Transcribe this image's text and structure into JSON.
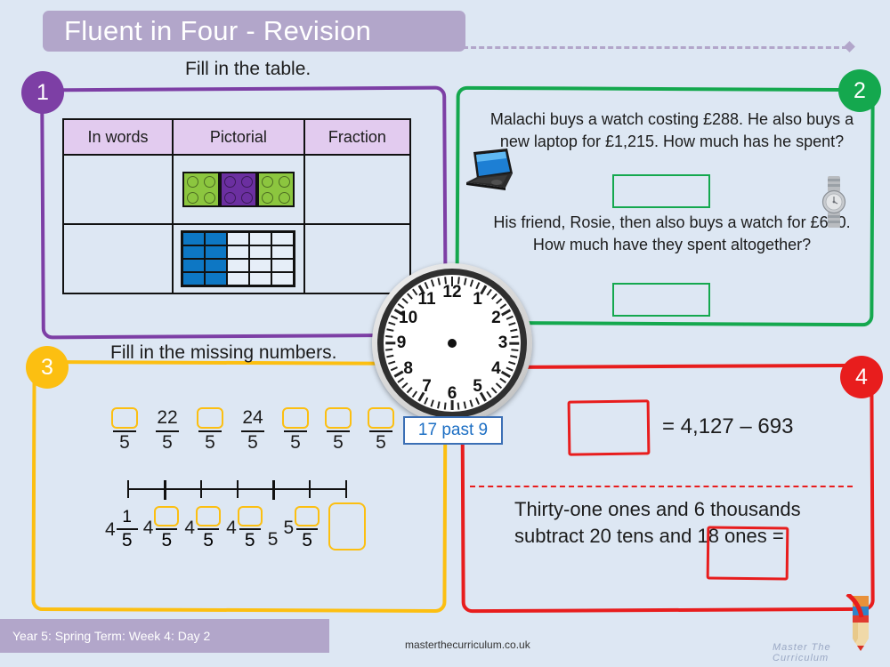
{
  "title": "Fluent in Four - Revision",
  "badges": {
    "one": "1",
    "two": "2",
    "three": "3",
    "four": "4"
  },
  "colors": {
    "background": "#dde7f3",
    "banner": "#b2a6ca",
    "purple": "#7d3fa5",
    "green": "#14a84e",
    "amber": "#fcbf11",
    "red": "#e81d1d",
    "table_header": "#e2cbef",
    "lego_green": "#8cc63f",
    "lego_purple": "#6b2fa0",
    "grid_blue": "#0d77c4",
    "clock_label_text": "#1d6fc4"
  },
  "section1": {
    "instruction": "Fill in the table.",
    "table": {
      "headers": [
        "In words",
        "Pictorial",
        "Fraction"
      ],
      "rows": [
        {
          "in_words": "",
          "pictorial": "lego-blocks",
          "fraction": ""
        },
        {
          "in_words": "",
          "pictorial": "shaded-grid",
          "fraction": ""
        }
      ],
      "lego": {
        "count": 3,
        "colors": [
          "green",
          "purple",
          "green"
        ],
        "studs_per_block": 4
      },
      "grid": {
        "cols": 5,
        "rows": 4,
        "shaded_cols": 2,
        "shaded_cells": 8,
        "total_cells": 20
      }
    }
  },
  "section2": {
    "text_a": "Malachi buys a watch costing £288.\nHe also buys a new laptop for £1,215.\nHow much has he spent?",
    "text_b": "His friend, Rosie, then also buys a watch for £610.\nHow much have they spent altogether?",
    "answer_box_1": "",
    "answer_box_2": "",
    "icons": [
      "laptop-image",
      "watch-image"
    ]
  },
  "section3": {
    "instruction": "Fill in the missing numbers.",
    "fraction_sequence": [
      {
        "numerator": "",
        "denominator": "5",
        "blank": true
      },
      {
        "numerator": "22",
        "denominator": "5",
        "blank": false
      },
      {
        "numerator": "",
        "denominator": "5",
        "blank": true
      },
      {
        "numerator": "24",
        "denominator": "5",
        "blank": false
      },
      {
        "numerator": "",
        "denominator": "5",
        "blank": true
      },
      {
        "numerator": "",
        "denominator": "5",
        "blank": true
      },
      {
        "numerator": "",
        "denominator": "5",
        "blank": true
      }
    ],
    "number_line": {
      "ticks": 7,
      "major_ticks": [
        1,
        4
      ]
    },
    "mixed_sequence": [
      {
        "whole": "4",
        "numerator": "1",
        "denominator": "5",
        "blank": false
      },
      {
        "whole": "4",
        "numerator": "",
        "denominator": "5",
        "blank": true
      },
      {
        "whole": "4",
        "numerator": "",
        "denominator": "5",
        "blank": true
      },
      {
        "whole": "4",
        "numerator": "",
        "denominator": "5",
        "blank": true
      },
      {
        "whole": "5",
        "numerator": null,
        "denominator": null,
        "blank": false
      },
      {
        "whole": "5",
        "numerator": "",
        "denominator": "5",
        "blank": true
      },
      {
        "whole": "",
        "numerator": null,
        "denominator": null,
        "blank": true,
        "big_box": true
      }
    ]
  },
  "section4": {
    "equation": "= 4,127 – 693",
    "answer_box_1": "",
    "word_problem": "Thirty-one ones and 6 thousands subtract 20 tens and 18 ones =",
    "answer_box_2": ""
  },
  "clock": {
    "label": "17 past 9",
    "hours": [
      "12",
      "1",
      "2",
      "3",
      "4",
      "5",
      "6",
      "7",
      "8",
      "9",
      "10",
      "11"
    ],
    "hands_shown": false
  },
  "footer": {
    "term_info": "Year 5: Spring Term: Week 4: Day 2",
    "url": "masterthecurriculum.co.uk",
    "logo_text": "Master The Curriculum"
  }
}
